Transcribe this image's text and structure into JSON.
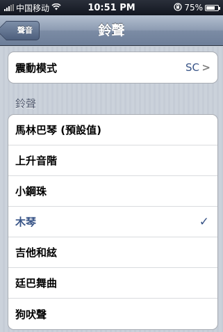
{
  "status_bar": {
    "carrier": "中国移动",
    "time": "10:51 PM",
    "battery_percent": "75%",
    "battery_level": 0.75,
    "wifi_icon": "wifi-icon",
    "lock_icon": "rotation-lock-icon"
  },
  "nav": {
    "back_label": "聲音",
    "title": "鈴聲"
  },
  "vibration": {
    "label": "震動模式",
    "value": "SC"
  },
  "section": {
    "header": "鈴聲"
  },
  "ringtones": [
    {
      "label": "馬林巴琴 (預設值)",
      "selected": false
    },
    {
      "label": "上升音階",
      "selected": false
    },
    {
      "label": "小鋼珠",
      "selected": false
    },
    {
      "label": "木琴",
      "selected": true
    },
    {
      "label": "吉他和絃",
      "selected": false
    },
    {
      "label": "廷巴舞曲",
      "selected": false
    },
    {
      "label": "狗吠聲",
      "selected": false
    }
  ],
  "colors": {
    "accent": "#385487",
    "nav_bar": "#7c8ca5"
  }
}
